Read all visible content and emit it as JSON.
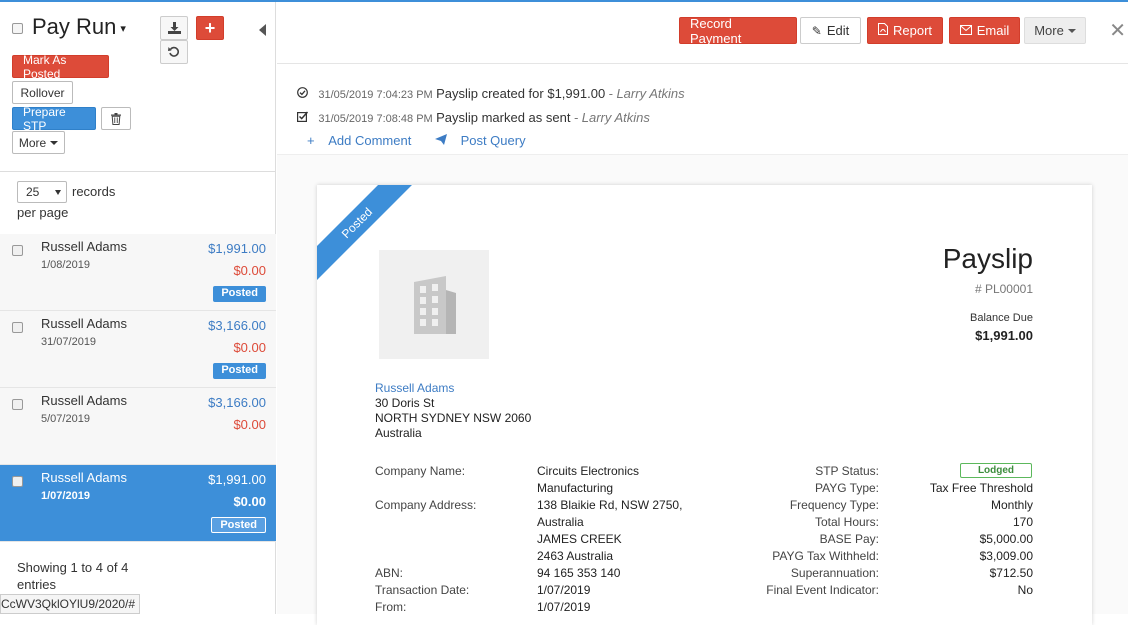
{
  "sidebar": {
    "title": "Pay Run",
    "buttons": {
      "mark_as_posted": "Mark As Posted",
      "rollover": "Rollover",
      "prepare_stp": "Prepare STP",
      "more": "More"
    },
    "records_per_page": {
      "value": "25",
      "label_records": "records",
      "label_per_page": "per page"
    },
    "items": [
      {
        "name": "Russell Adams",
        "date": "1/08/2019",
        "amount": "$1,991.00",
        "balance": "$0.00",
        "status": "Posted"
      },
      {
        "name": "Russell Adams",
        "date": "31/07/2019",
        "amount": "$3,166.00",
        "balance": "$0.00",
        "status": "Posted"
      },
      {
        "name": "Russell Adams",
        "date": "5/07/2019",
        "amount": "$3,166.00",
        "balance": "$0.00",
        "status": ""
      },
      {
        "name": "Russell Adams",
        "date": "1/07/2019",
        "amount": "$1,991.00",
        "balance": "$0.00",
        "status": "Posted"
      }
    ],
    "showing": "Showing 1 to 4 of 4 entries",
    "url_tip": "CcWV3QklOYlU9/2020/#"
  },
  "header": {
    "record_payment": "Record Payment",
    "edit": "Edit",
    "report": "Report",
    "email": "Email",
    "more": "More"
  },
  "activity": [
    {
      "timestamp": "31/05/2019 7:04:23 PM",
      "message": "Payslip created for $1,991.00",
      "by": "- Larry Atkins"
    },
    {
      "timestamp": "31/05/2019 7:08:48 PM",
      "message": "Payslip marked as sent",
      "by": "- Larry Atkins"
    }
  ],
  "activity_links": {
    "add_comment": "Add Comment",
    "post_query": "Post Query"
  },
  "payslip": {
    "ribbon": "Posted",
    "title": "Payslip",
    "number": "# PL00001",
    "balance_due_label": "Balance Due",
    "balance_due": "$1,991.00",
    "employee": {
      "name": "Russell Adams",
      "street": "30 Doris St",
      "city": "NORTH SYDNEY NSW 2060",
      "country": "Australia"
    },
    "left_fields": {
      "company_name_label": "Company Name:",
      "company_name_1": "Circuits Electronics",
      "company_name_2": "Manufacturing",
      "company_address_label": "Company Address:",
      "company_address_1": "138 Blaikie Rd, NSW 2750,",
      "company_address_2": "Australia",
      "company_address_3": "JAMES CREEK",
      "company_address_4": "2463 Australia",
      "abn_label": "ABN:",
      "abn": "94 165 353 140",
      "transaction_date_label": "Transaction Date:",
      "transaction_date": "1/07/2019",
      "from_label": "From:",
      "from": "1/07/2019"
    },
    "right_fields": {
      "stp_status_label": "STP Status:",
      "stp_status": "Lodged",
      "payg_type_label": "PAYG Type:",
      "payg_type": "Tax Free Threshold",
      "frequency_type_label": "Frequency Type:",
      "frequency_type": "Monthly",
      "total_hours_label": "Total Hours:",
      "total_hours": "170",
      "base_pay_label": "BASE Pay:",
      "base_pay": "$5,000.00",
      "payg_tax_label": "PAYG Tax Withheld:",
      "payg_tax": "$3,009.00",
      "super_label": "Superannuation:",
      "super": "$712.50",
      "final_event_label": "Final Event Indicator:",
      "final_event": "No"
    }
  },
  "colors": {
    "accent": "#3d8fd9",
    "danger": "#dd4b39",
    "success": "#5cb85c"
  }
}
